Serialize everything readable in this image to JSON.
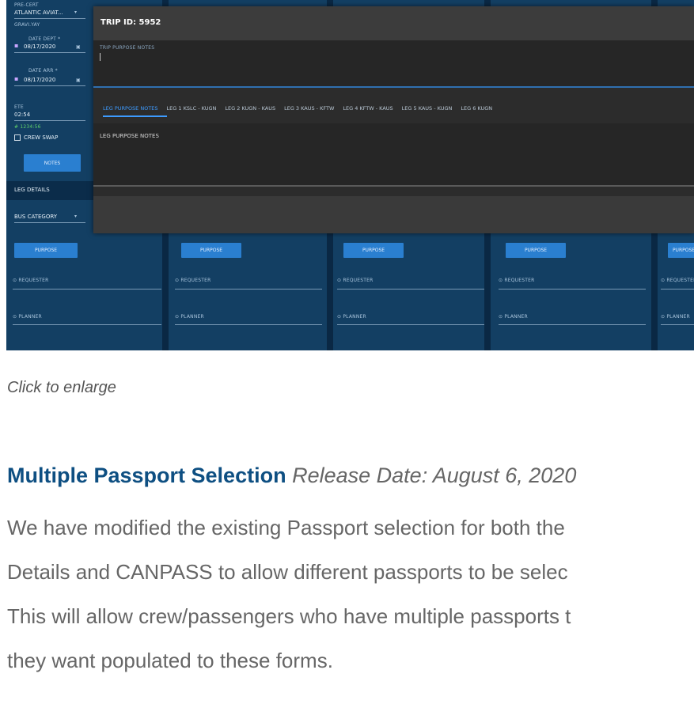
{
  "screenshot": {
    "modal": {
      "title": "TRIP ID: 5952",
      "trip_notes_label": "TRIP PURPOSE NOTES",
      "tabs": [
        "LEG PURPOSE NOTES",
        "LEG 1 KSLC - KUGN",
        "LEG 2 KUGN - KAUS",
        "LEG 3 KAUS - KFTW",
        "LEG 4 KFTW - KAUS",
        "LEG 5 KAUS - KUGN",
        "LEG 6 KUGN"
      ],
      "leg_notes_label": "LEG PURPOSE NOTES"
    },
    "left_panel": {
      "field_label_0": "PRE-CERT",
      "operator_value": "ATLANTIC AVIAT...",
      "operator_sub": "GRAVI.YAY",
      "date_dept_label": "DATE DEPT *",
      "date_dept_value": "08/17/2020",
      "date_arr_label": "DATE ARR *",
      "date_arr_value": "08/17/2020",
      "ete_label": "ETE",
      "ete_value": "02:54",
      "ete_sub": "# 1234:56",
      "crew_swap": "CREW SWAP",
      "notes_button": "NOTES",
      "leg_details": "LEG DETAILS",
      "bus_category": "BUS CATEGORY"
    },
    "columns": {
      "purpose_button": "PURPOSE",
      "requester": "REQUESTER",
      "planner": "PLANNER"
    }
  },
  "caption": "Click to enlarge",
  "article": {
    "title": "Multiple Passport Selection",
    "release_date": "Release Date: August 6, 2020",
    "lines": [
      "We have modified the existing Passport selection for both the",
      "Details and CANPASS to allow different passports to be selec",
      "This will allow crew/passengers who have multiple passports t",
      "they want populated to these forms."
    ]
  },
  "colors": {
    "headline": "#0e4f82",
    "body_text": "#666666",
    "app_background": "#0f3a5e",
    "accent_blue": "#2a7fd0",
    "modal_background": "#2c2c2c"
  }
}
